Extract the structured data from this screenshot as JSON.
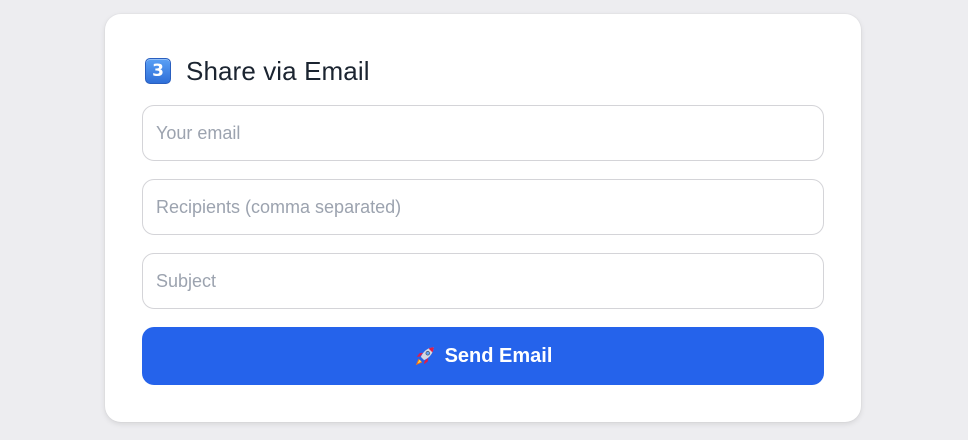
{
  "form": {
    "step_number": "3",
    "title": "Share via Email",
    "fields": {
      "your_email": {
        "value": "",
        "placeholder": "Your email"
      },
      "recipients": {
        "value": "",
        "placeholder": "Recipients (comma separated)"
      },
      "subject": {
        "value": "",
        "placeholder": "Subject"
      }
    },
    "send_button": {
      "icon": "rocket-icon",
      "label": "Send Email"
    }
  },
  "colors": {
    "page_background": "#ededf0",
    "card_background": "#ffffff",
    "primary_button": "#2563eb",
    "step_badge": "#3b82f6",
    "placeholder_text": "#9ca3af",
    "title_text": "#1b2430"
  }
}
